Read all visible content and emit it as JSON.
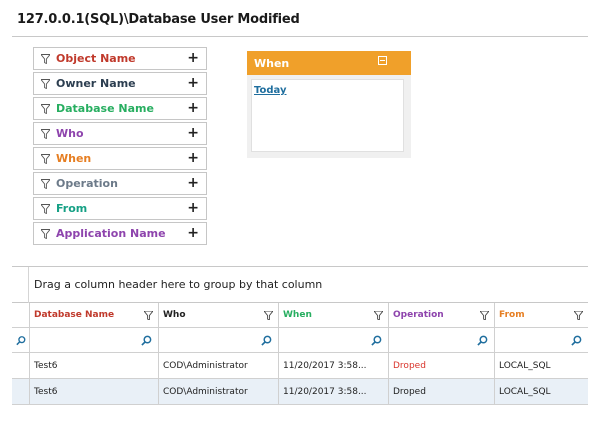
{
  "title": "127.0.0.1(SQL)\\Database User Modified",
  "filters": [
    {
      "label": "Object Name",
      "color": "#c0392b"
    },
    {
      "label": "Owner Name",
      "color": "#2c3e50"
    },
    {
      "label": "Database Name",
      "color": "#27ae60"
    },
    {
      "label": "Who",
      "color": "#8e44ad"
    },
    {
      "label": "When",
      "color": "#e67e22"
    },
    {
      "label": "Operation",
      "color": "#6c7a89"
    },
    {
      "label": "From",
      "color": "#16a085"
    },
    {
      "label": "Application Name",
      "color": "#8e44ad"
    }
  ],
  "when_panel": {
    "title": "When",
    "link": "Today",
    "header_color": "#f0a02a"
  },
  "group_panel_text": "Drag a column header here to group by that column",
  "grid": {
    "columns": [
      {
        "label": "Database Name",
        "color": "#c0392b"
      },
      {
        "label": "Who",
        "color": "#222222"
      },
      {
        "label": "When",
        "color": "#27ae60"
      },
      {
        "label": "Operation",
        "color": "#8e44ad"
      },
      {
        "label": "From",
        "color": "#e67e22"
      }
    ],
    "rows": [
      {
        "db": "Test6",
        "who": "COD\\Administrator",
        "when": "11/20/2017 3:58...",
        "operation": "Droped",
        "operation_color": "#d9342b",
        "from": "LOCAL_SQL"
      },
      {
        "db": "Test6",
        "who": "COD\\Administrator",
        "when": "11/20/2017 3:58...",
        "operation": "Droped",
        "operation_color": "#222222",
        "from": "LOCAL_SQL"
      }
    ]
  }
}
